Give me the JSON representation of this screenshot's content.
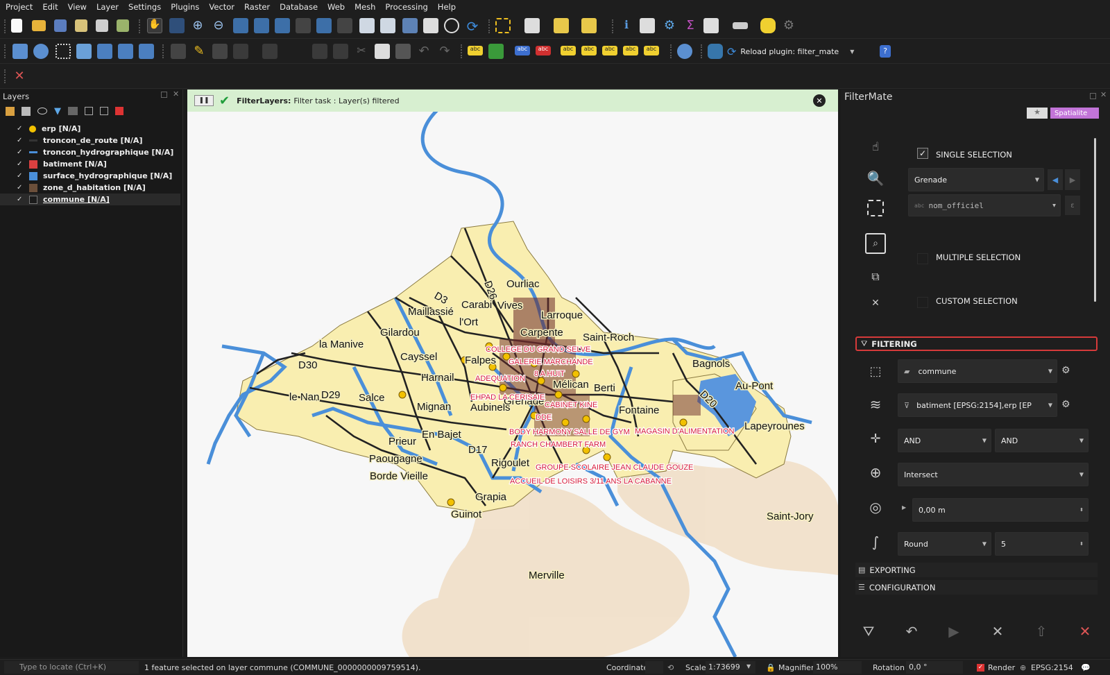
{
  "menu": [
    "Project",
    "Edit",
    "View",
    "Layer",
    "Settings",
    "Plugins",
    "Vector",
    "Raster",
    "Database",
    "Web",
    "Mesh",
    "Processing",
    "Help"
  ],
  "toolbar": {
    "reload_plugin_label": "Reload plugin: filter_mate"
  },
  "layers_panel": {
    "title": "Layers",
    "items": [
      {
        "name": "erp [N/A]",
        "symbol": "point",
        "color": "#f2c100"
      },
      {
        "name": "troncon_de_route [N/A]",
        "symbol": "line",
        "color": "#333333"
      },
      {
        "name": "troncon_hydrographique [N/A]",
        "symbol": "line",
        "color": "#4a8fd9"
      },
      {
        "name": "batiment [N/A]",
        "symbol": "fill",
        "color": "#d94040"
      },
      {
        "name": "surface_hydrographique [N/A]",
        "symbol": "fill",
        "color": "#4a8fd9"
      },
      {
        "name": "zone_d_habitation [N/A]",
        "symbol": "fill",
        "color": "#6b4f3a"
      },
      {
        "name": "commune [N/A]",
        "symbol": "fill",
        "color": "#1b1b1b"
      }
    ]
  },
  "message_bar": {
    "title": "FilterLayers:",
    "text": "Filter task : Layer(s) filtered"
  },
  "map": {
    "place_labels": [
      "Ourliac",
      "Carabi",
      "Vives",
      "Maillassié",
      "l'Ort",
      "Larroque",
      "Gilardou",
      "Carpente",
      "Saint-Roch",
      "la Manive",
      "Cayssel",
      "Falpes",
      "Harnail",
      "Mélican",
      "Berti",
      "Bagnols",
      "Au-Pont",
      "le Nan",
      "Salce",
      "Mignan",
      "Aubinels",
      "Fontaine",
      "Lapeyrounes",
      "Prieur",
      "En Bajet",
      "Paougagne",
      "Rigoulet",
      "Borde Vieille",
      "Grapia",
      "Guinot",
      "Saint-Jory",
      "Merville",
      "Grenade",
      "D3",
      "D26",
      "D30",
      "D29",
      "D17",
      "D20"
    ],
    "poi_labels": [
      "COLLEGE DU GRAND SELVE",
      "GALERIE MARCHANDE",
      "8 A HUIT",
      "ADEQUATION",
      "EHPAD LA CERISAIE",
      "CABINET KINE",
      "DDE",
      "BODY HARMONY SALLE DE GYM",
      "MAGASIN D'ALIMENTATION",
      "RANCH CHAMBERT FARM",
      "GROUPE SCOLAIRE JEAN CLAUDE GOUZE",
      "ACCUEIL DE LOISIRS 3/11 ANS LA CABANNE"
    ]
  },
  "filtermate": {
    "title": "FilterMate",
    "badge": "Spatialite",
    "single_selection": "SINGLE SELECTION",
    "multiple_selection": "MULTIPLE SELECTION",
    "custom_selection": "CUSTOM SELECTION",
    "selected_feature": "Grenade",
    "field": "nom_officiel",
    "filtering": "FILTERING",
    "source_layer": "commune",
    "target_layers": "batiment [EPSG:2154],erp [EP",
    "combine_op_1": "AND",
    "combine_op_2": "AND",
    "predicate": "Intersect",
    "buffer": "0,00 m",
    "buffer_style": "Round",
    "segments": "5",
    "exporting": "EXPORTING",
    "configuration": "CONFIGURATION"
  },
  "status": {
    "locate_placeholder": "Type to locate (Ctrl+K)",
    "message": "1 feature selected on layer commune (COMMUNE_0000000009759514).",
    "coordinate_label": "Coordinate",
    "scale_label": "Scale",
    "scale": "1:73699",
    "magnifier_label": "Magnifier",
    "magnifier": "100%",
    "rotation_label": "Rotation",
    "rotation": "0,0 °",
    "render_label": "Render",
    "crs": "EPSG:2154"
  }
}
